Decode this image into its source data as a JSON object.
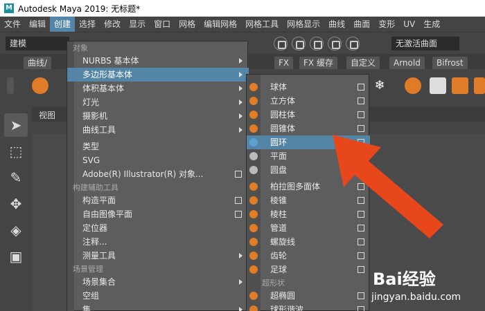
{
  "window": {
    "title": "Autodesk Maya 2019: 无标题*",
    "logo_letter": "M"
  },
  "menubar": {
    "items": [
      "文件",
      "编辑",
      "创建",
      "选择",
      "修改",
      "显示",
      "窗口",
      "网格",
      "编辑网格",
      "网格工具",
      "网格显示",
      "曲线",
      "曲面",
      "变形",
      "UV",
      "生成"
    ],
    "active": "创建"
  },
  "status_line": {
    "mode": "建模",
    "live_surface": "无激活曲面"
  },
  "shelf": {
    "left_tab": "曲线/",
    "tabs": [
      "FX",
      "FX 缓存",
      "自定义",
      "Arnold",
      "Bifrost"
    ]
  },
  "viewport": {
    "panel_label": "视图"
  },
  "create_menu": {
    "top_section": "对象",
    "items": [
      {
        "label": "NURBS 基本体",
        "submenu": true
      },
      {
        "label": "多边形基本体",
        "submenu": true,
        "highlight": true
      },
      {
        "label": "体积基本体",
        "submenu": true
      },
      {
        "label": "灯光",
        "submenu": true
      },
      {
        "label": "摄影机",
        "submenu": true
      },
      {
        "label": "曲线工具",
        "submenu": true
      },
      {
        "label": "类型"
      },
      {
        "label": "SVG"
      },
      {
        "label": "Adobe(R) Illustrator(R) 对象...",
        "option_box": true
      }
    ],
    "section_construction": "构建辅助工具",
    "construction_items": [
      {
        "label": "构造平面",
        "option_box": true
      },
      {
        "label": "自由图像平面",
        "option_box": true
      },
      {
        "label": "定位器"
      },
      {
        "label": "注释..."
      },
      {
        "label": "测量工具",
        "submenu": true
      }
    ],
    "section_scene": "场景管理",
    "scene_items": [
      {
        "label": "场景集合",
        "submenu": true
      },
      {
        "label": "空组"
      },
      {
        "label": "集",
        "submenu": true
      }
    ]
  },
  "polygon_submenu": {
    "items": [
      {
        "label": "球体"
      },
      {
        "label": "立方体"
      },
      {
        "label": "圆柱体"
      },
      {
        "label": "圆锥体"
      },
      {
        "label": "圆环",
        "highlight": true
      },
      {
        "label": "平面"
      },
      {
        "label": "圆盘"
      },
      {
        "label": "柏拉图多面体"
      },
      {
        "label": "棱锥"
      },
      {
        "label": "棱柱"
      },
      {
        "label": "管道"
      },
      {
        "label": "螺旋线"
      },
      {
        "label": "齿轮"
      },
      {
        "label": "足球"
      }
    ],
    "section_super": "超形状",
    "super_items": [
      {
        "label": "超椭圆"
      },
      {
        "label": "球形谐波"
      }
    ]
  },
  "colors": {
    "highlight": "#5285a6",
    "annotation_arrow": "#e8471c",
    "menu_bg": "#5d5d5d"
  },
  "watermark": {
    "brand": "Bai经验",
    "url": "jingyan.baidu.com"
  }
}
